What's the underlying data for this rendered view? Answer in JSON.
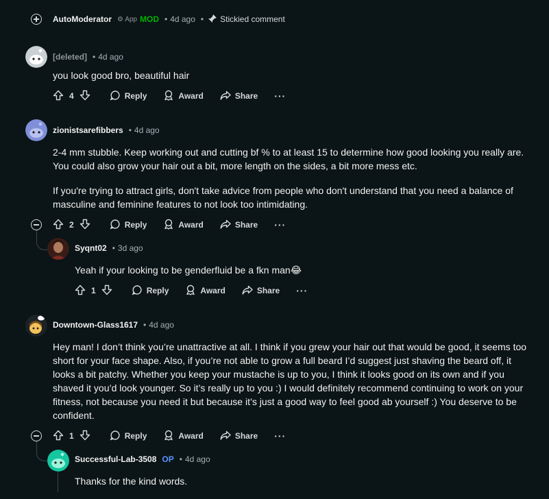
{
  "top_comment": {
    "author": "AutoModerator",
    "app_label": "App",
    "mod_label": "MOD",
    "time": "4d ago",
    "stickied": "Stickied comment"
  },
  "comments": [
    {
      "author": "[deleted]",
      "time": "4d ago",
      "body": [
        "you look good bro, beautiful hair"
      ],
      "votes": "4"
    },
    {
      "author": "zionistsarefibbers",
      "time": "4d ago",
      "body": [
        "2-4 mm stubble. Keep working out and cutting bf % to at least 15 to determine how good looking you really are. You could also grow your hair out a bit, more length on the sides, a bit more mess etc.",
        "If you're trying to attract girls, don't take advice from people who don't understand that you need a balance of masculine and feminine features to not look too intimidating."
      ],
      "votes": "2"
    },
    {
      "author": "Syqnt02",
      "time": "3d ago",
      "body": [
        "Yeah if your looking to be genderfluid be a fkn man😂"
      ],
      "votes": "1"
    },
    {
      "author": "Downtown-Glass1617",
      "time": "4d ago",
      "body": [
        "Hey man! I don’t think you’re unattractive at all. I think if you grew your hair out that would be good, it seems too short for your face shape. Also, if you’re not able to grow a full beard I’d suggest just shaving the beard off, it looks a bit patchy. Whether you keep your mustache is up to you, I think it looks good on its own and if you shaved it you’d look younger. So it’s really up to you :) I would definitely recommend continuing to work on your fitness, not because you need it but because it’s just a good way to feel good ab yourself :) You deserve to be confident."
      ],
      "votes": "1"
    },
    {
      "author": "Successful-Lab-3508",
      "op_label": "OP",
      "time": "4d ago",
      "body": [
        "Thanks for the kind words."
      ]
    }
  ],
  "actions": {
    "reply": "Reply",
    "award": "Award",
    "share": "Share",
    "more": "···"
  },
  "separator": "•",
  "colors": {
    "background": "#0b1416",
    "mod_green": "#00b200",
    "op_blue": "#5896ff",
    "text": "#f2f2f2",
    "meta": "#a5b1b5"
  }
}
